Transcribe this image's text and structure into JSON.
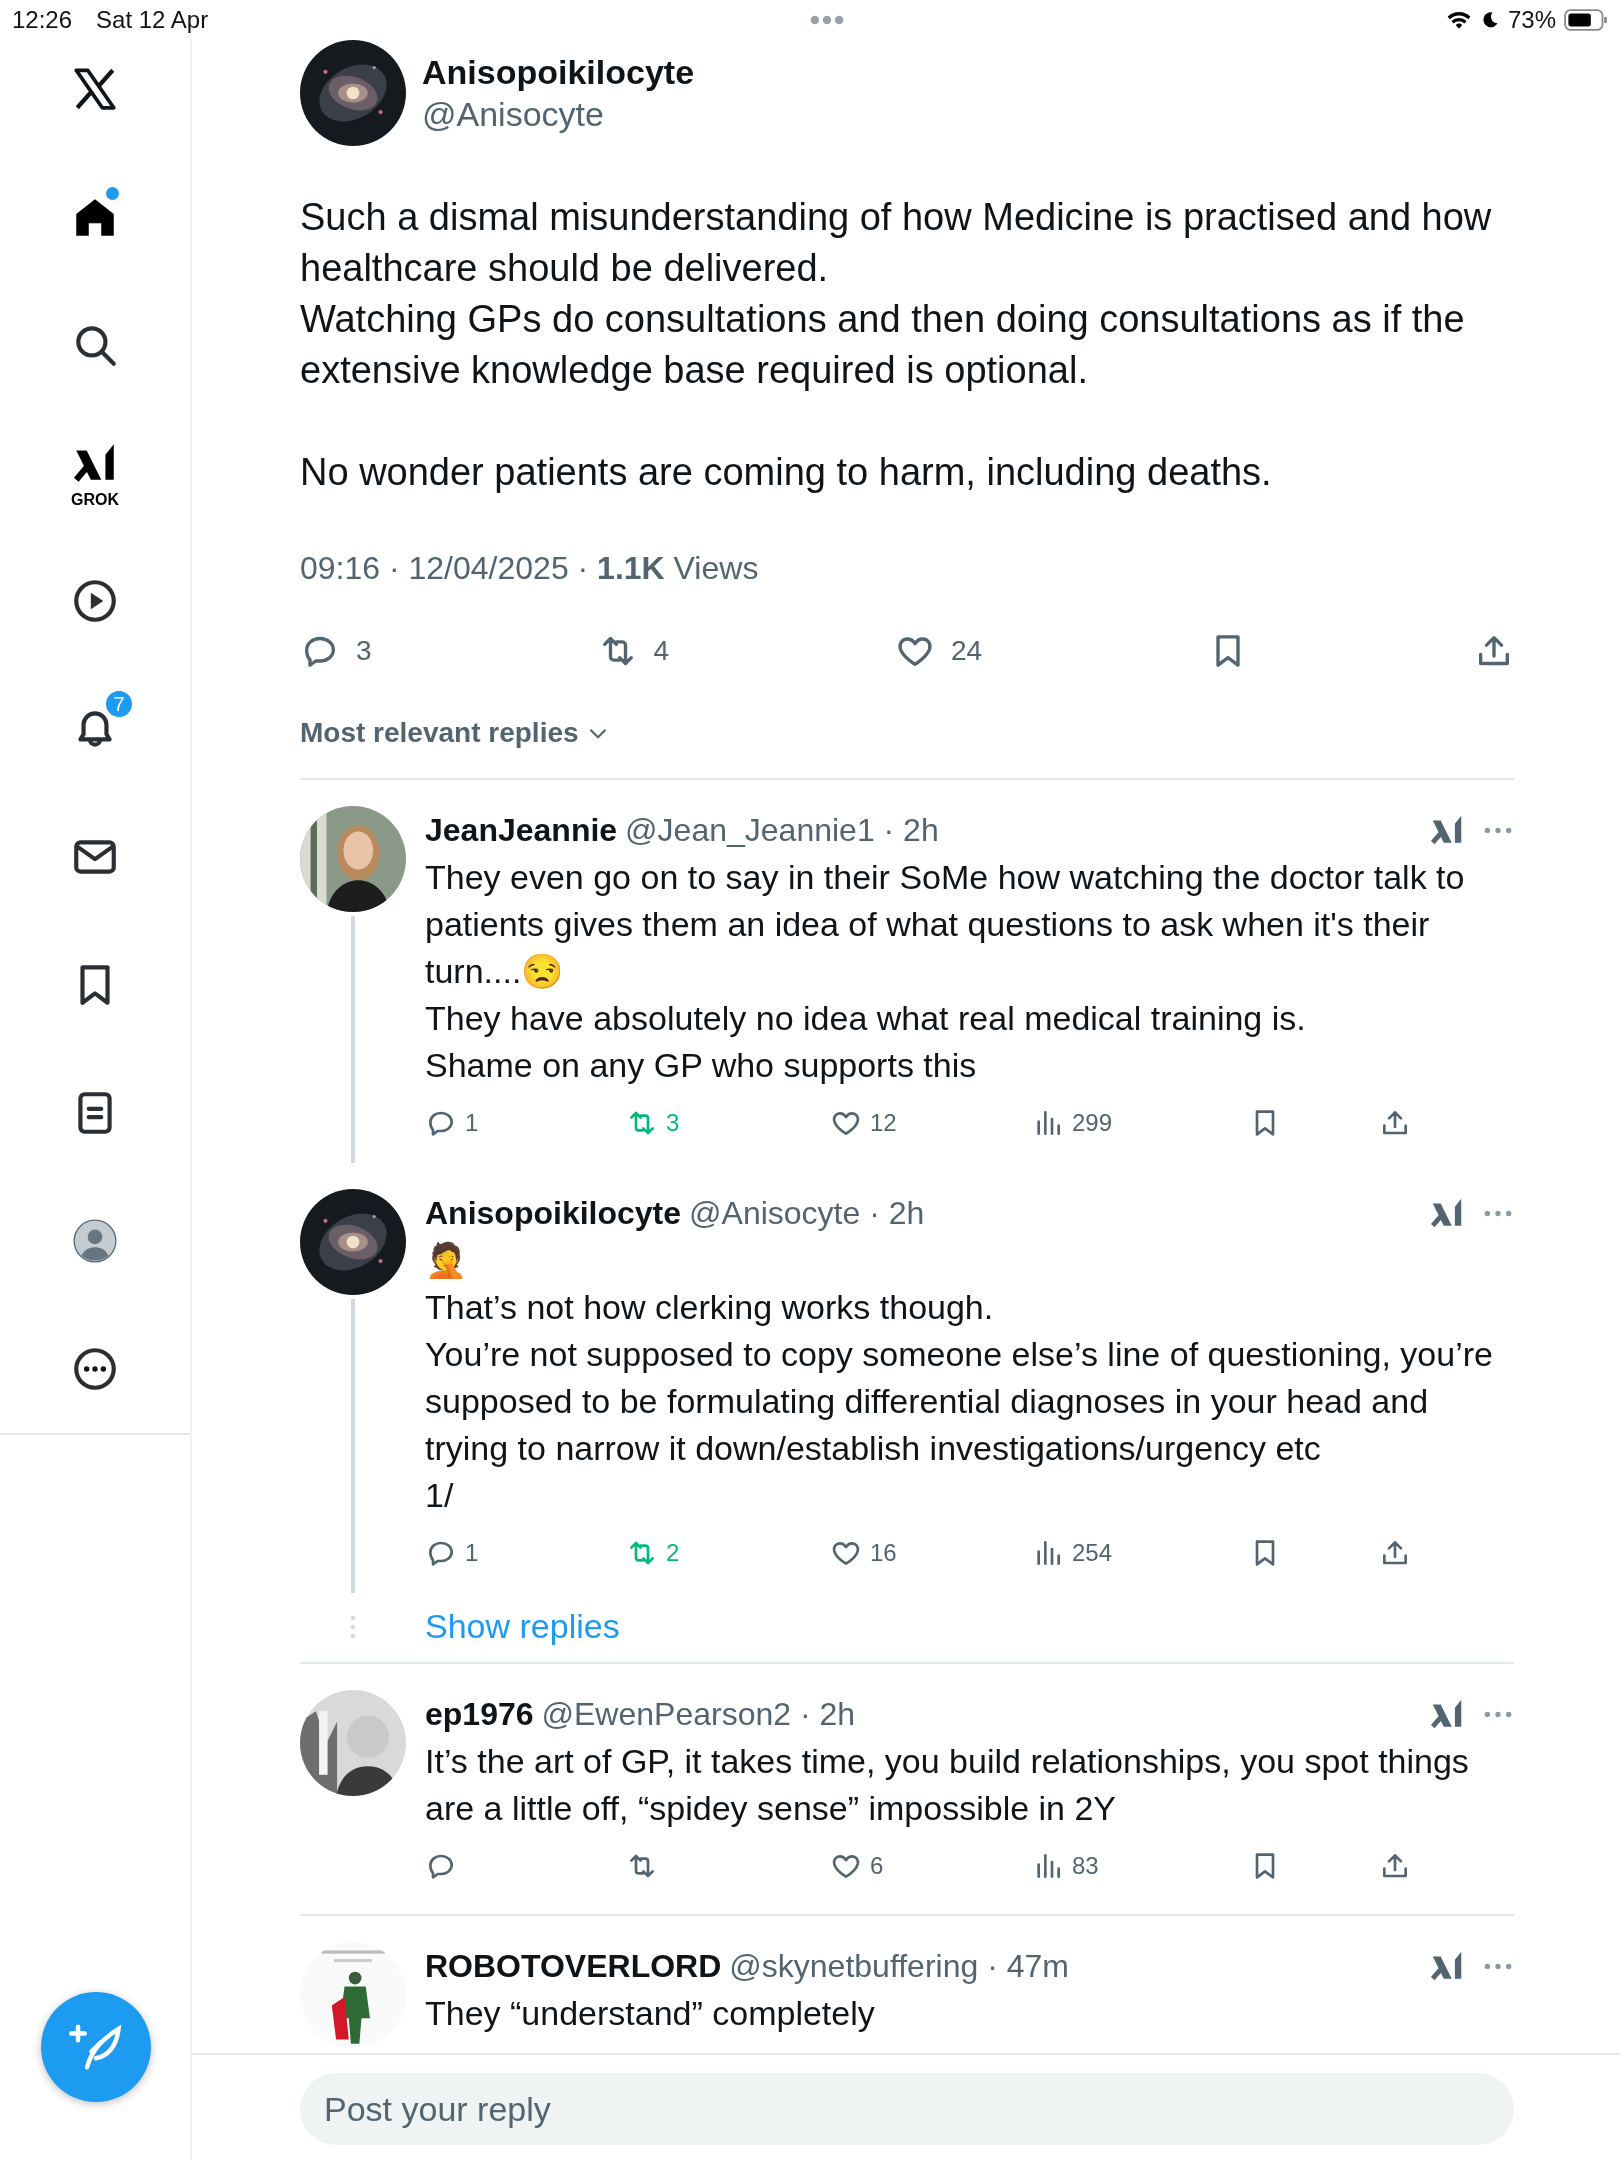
{
  "status_bar": {
    "time": "12:26",
    "date": "Sat 12 Apr",
    "battery": "73%"
  },
  "sidebar": {
    "items": [
      {
        "kind": "home",
        "selected": true,
        "has_dot": true
      },
      {
        "kind": "search",
        "selected": false,
        "has_dot": false
      },
      {
        "kind": "grok",
        "label": "GROK",
        "selected": false,
        "has_dot": false
      },
      {
        "kind": "video",
        "selected": false,
        "has_dot": false
      },
      {
        "kind": "notifications",
        "badge": "7",
        "selected": false,
        "has_dot": false
      },
      {
        "kind": "messages",
        "selected": false,
        "has_dot": false
      },
      {
        "kind": "bookmarks",
        "selected": false,
        "has_dot": false
      },
      {
        "kind": "lists",
        "selected": false,
        "has_dot": false
      },
      {
        "kind": "profile",
        "selected": false,
        "has_dot": false
      },
      {
        "kind": "more",
        "selected": false,
        "has_dot": false
      }
    ]
  },
  "tweet": {
    "name": "Anisopoikilocyte",
    "handle": "@Anisocyte",
    "text": "Such a dismal misunderstanding of how Medicine is practised and how healthcare should be delivered.\nWatching GPs do consultations and then doing consultations as if the extensive knowledge base required is optional.\n\nNo wonder patients are coming to harm, including deaths.",
    "meta": "09:16 · 12/04/2025 · **1.1K** Views",
    "actions": [
      {
        "kind": "reply",
        "count": "3"
      },
      {
        "kind": "repost",
        "count": "4",
        "active": false
      },
      {
        "kind": "like",
        "count": "24"
      },
      {
        "kind": "bookmark"
      },
      {
        "kind": "share"
      }
    ]
  },
  "sort": {
    "label": "Most relevant replies"
  },
  "threads": [
    {
      "replies": [
        {
          "name": "JeanJeannie",
          "meta": "@Jean_Jeannie1 · 2h",
          "text": "They even go on to say in their SoMe how watching the doctor talk to patients gives them an idea of what questions to ask when it's their turn....😒\nThey have absolutely no idea what real medical training is.\nShame on any GP who supports this",
          "actions": [
            {
              "kind": "reply",
              "count": "1"
            },
            {
              "kind": "repost",
              "count": "3",
              "active": true
            },
            {
              "kind": "like",
              "count": "12"
            },
            {
              "kind": "views",
              "count": "299"
            },
            {
              "kind": "bookmark"
            },
            {
              "kind": "share"
            }
          ]
        },
        {
          "name": "Anisopoikilocyte",
          "meta": "@Anisocyte · 2h",
          "text": "🤦\nThat’s not how clerking works though.\nYou’re not supposed to copy someone else’s line of questioning, you’re supposed to be formulating differential diagnoses in your head and trying to narrow it down/establish investigations/urgency etc\n1/",
          "actions": [
            {
              "kind": "reply",
              "count": "1"
            },
            {
              "kind": "repost",
              "count": "2",
              "active": true
            },
            {
              "kind": "like",
              "count": "16"
            },
            {
              "kind": "views",
              "count": "254"
            },
            {
              "kind": "bookmark"
            },
            {
              "kind": "share"
            }
          ]
        }
      ],
      "more": "Show replies"
    },
    {
      "replies": [
        {
          "name": "ep1976",
          "meta": "@EwenPearson2 · 2h",
          "text": "It’s the art of GP, it takes time, you build relationships, you spot things are a little off, “spidey sense” impossible in 2Y",
          "actions": [
            {
              "kind": "reply"
            },
            {
              "kind": "repost",
              "active": false
            },
            {
              "kind": "like",
              "count": "6"
            },
            {
              "kind": "views",
              "count": "83"
            },
            {
              "kind": "bookmark"
            },
            {
              "kind": "share"
            }
          ]
        }
      ]
    },
    {
      "replies": [
        {
          "name": "ROBOTOVERLORD",
          "meta": "@skynetbuffering · 47m",
          "text": "They “understand” completely"
        }
      ]
    }
  ],
  "reply_box": {
    "placeholder": "Post your reply"
  }
}
